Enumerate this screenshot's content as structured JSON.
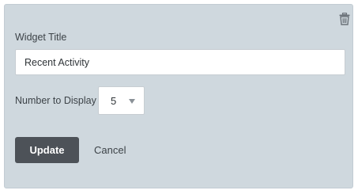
{
  "widget_form": {
    "title_label": "Widget Title",
    "title_value": "Recent Activity",
    "number_label": "Number to Display",
    "number_selected": "5",
    "update_label": "Update",
    "cancel_label": "Cancel",
    "delete_icon": "trash-icon"
  },
  "colors": {
    "panel_bg": "#cfd8de",
    "button_bg": "#4d5258",
    "text": "#3d4348"
  }
}
